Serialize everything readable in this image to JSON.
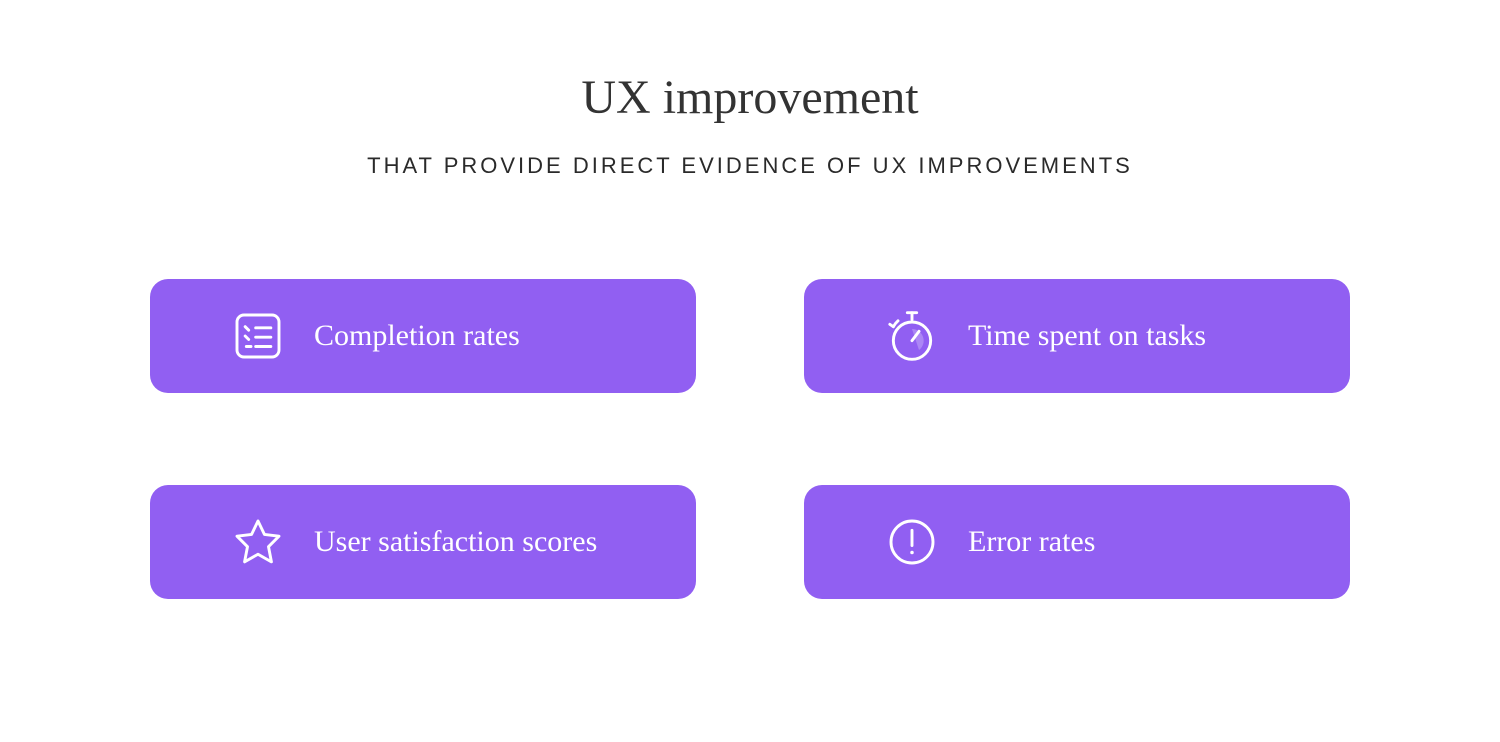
{
  "title": "UX improvement",
  "subtitle": "THAT PROVIDE DIRECT EVIDENCE OF UX IMPROVEMENTS",
  "cards": [
    {
      "label": "Completion rates",
      "icon": "checklist-icon"
    },
    {
      "label": "Time spent on tasks",
      "icon": "stopwatch-icon"
    },
    {
      "label": "User satisfaction scores",
      "icon": "star-icon"
    },
    {
      "label": "Error rates",
      "icon": "error-icon"
    }
  ],
  "colors": {
    "card_bg": "#915ff2",
    "title": "#333333",
    "subtitle": "#2a2a2a",
    "card_text": "#ffffff"
  }
}
